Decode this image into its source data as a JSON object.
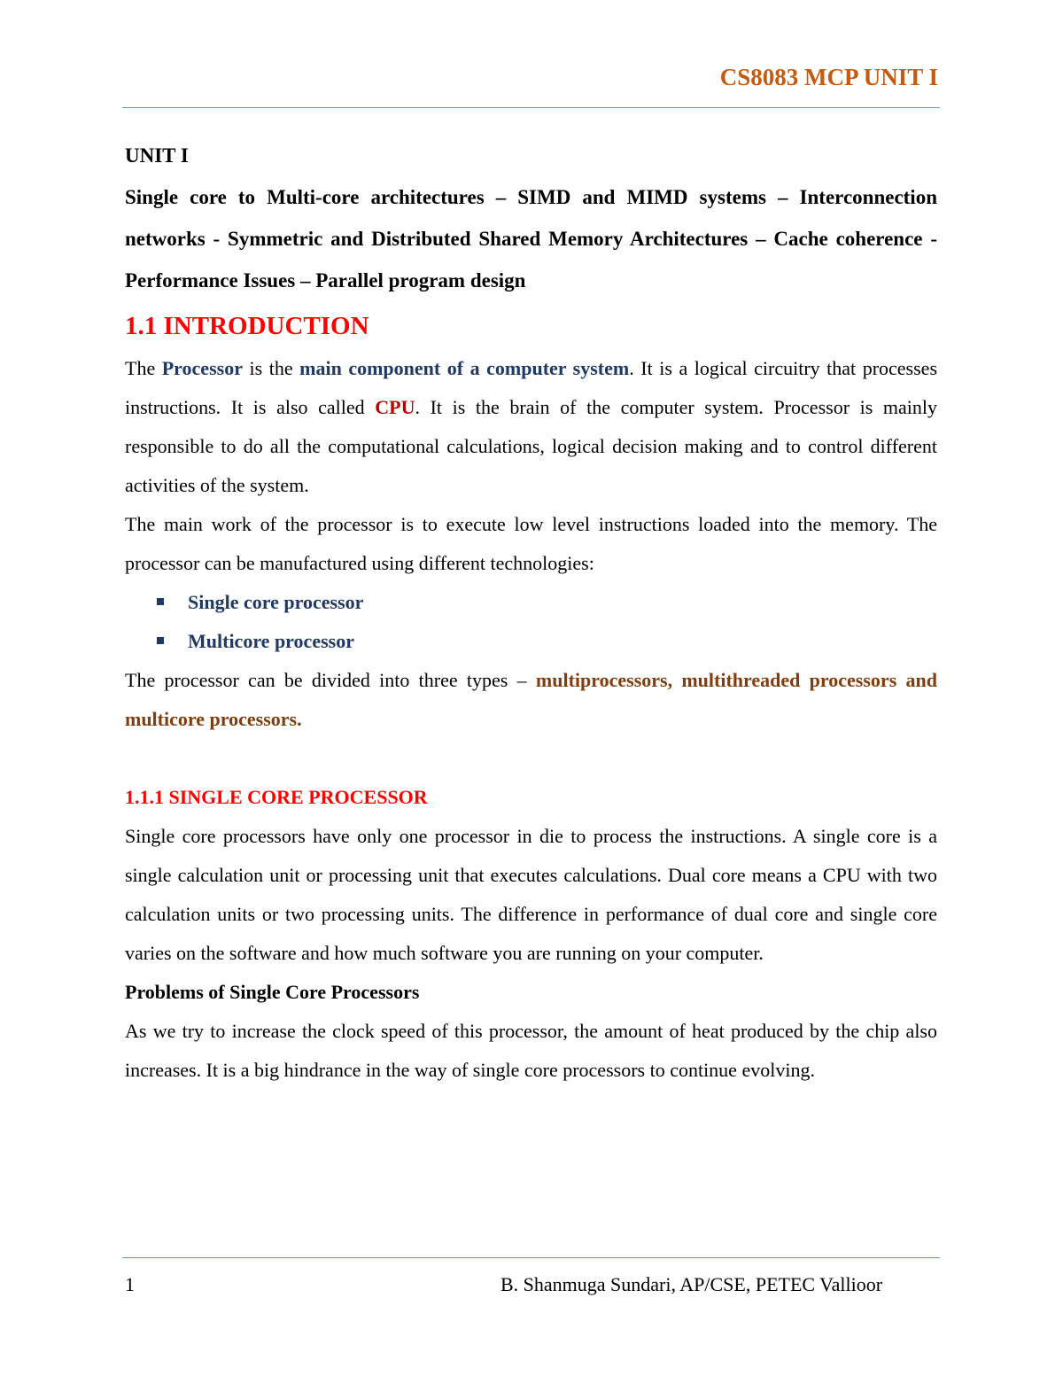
{
  "header": {
    "title": "CS8083 MCP UNIT I",
    "accent_color": "#c55a11",
    "rule_color": "#5b9bd5"
  },
  "unit": {
    "title": "UNIT I",
    "topics": "Single core to Multi-core architectures – SIMD and MIMD systems – Interconnection networks - Symmetric and Distributed Shared Memory Architectures – Cache coherence - Performance Issues – Parallel program design"
  },
  "section_1_1": {
    "heading": "1.1 INTRODUCTION",
    "para1": {
      "t1": "The ",
      "k1": "Processor",
      "t2": " is the ",
      "k2": "main component of a computer system",
      "t3": ". It is a logical circuitry that processes instructions. It is also called ",
      "k3": "CPU",
      "t4": ". It is the brain of the computer system. Processor is mainly responsible to do all the computational calculations, logical decision making and to control different activities of the system."
    },
    "para2": "The main work of the processor is to execute low level instructions loaded into the memory. The processor can be manufactured using different technologies:",
    "bullets": [
      "Single core processor",
      "Multicore processor"
    ],
    "para3": {
      "t1": "The processor can be divided into three types – ",
      "k1": "multiprocessors, multithreaded processors and multicore processors."
    }
  },
  "section_1_1_1": {
    "heading": "1.1.1 SINGLE CORE PROCESSOR",
    "para1": "Single core processors have only one processor in die to process the instructions. A single core is a single calculation unit or processing unit that executes calculations. Dual core means a CPU with two calculation units or two processing units. The difference in performance of dual core and single core varies on the software and how much software you are running on your computer.",
    "subheading": "Problems of Single Core Processors",
    "para2": "As we try to increase the clock speed of this processor, the amount of heat produced by the chip also increases. It is a big hindrance in the way of single core processors to continue evolving."
  },
  "footer": {
    "page_number": "1",
    "author": "B. Shanmuga Sundari, AP/CSE, PETEC Vallioor"
  }
}
